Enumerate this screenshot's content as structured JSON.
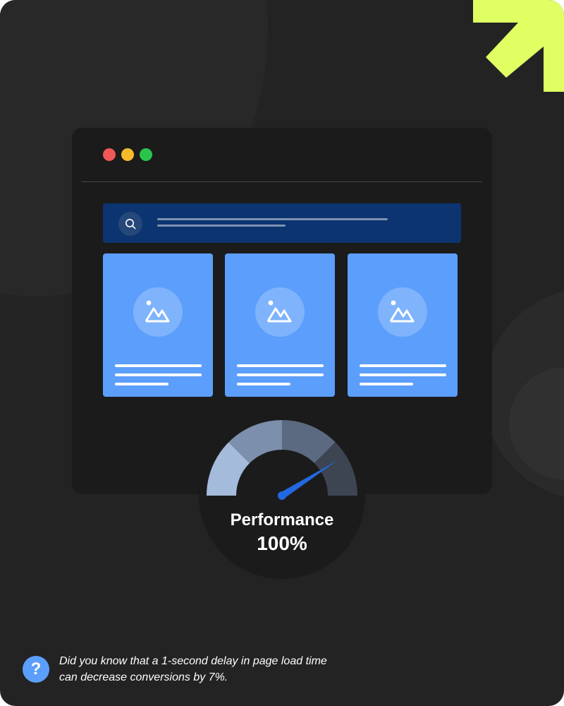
{
  "colors": {
    "background": "#232323",
    "accent_arrow": "#dfff63",
    "browser_window": "#1b1b1b",
    "search_bar": "#0c3470",
    "card_blue": "#5c9efb",
    "needle": "#2368e0",
    "traffic_lights": [
      "#f05757",
      "#f6b92b",
      "#2ac34e"
    ]
  },
  "icons": {
    "arrow": "arrow-up-right-icon",
    "search": "search-icon",
    "image_placeholder": "image-icon",
    "question": "question-mark-icon"
  },
  "gauge": {
    "title": "Performance",
    "value": "100%",
    "needle_level": 0.82,
    "segment_colors": [
      "#a4bbdb",
      "#7c8fab",
      "#5b6a80",
      "#3d4553"
    ]
  },
  "fact": {
    "icon_glyph": "?",
    "text": "Did you know that a 1-second delay in page load time can decrease conversions by 7%."
  }
}
